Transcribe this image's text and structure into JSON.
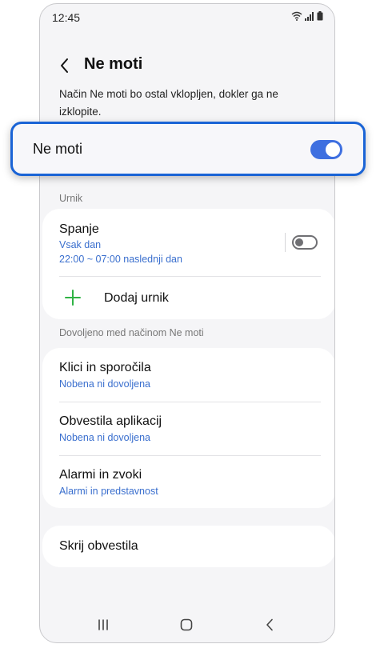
{
  "status_bar": {
    "time": "12:45"
  },
  "header": {
    "title": "Ne moti"
  },
  "description": "Način Ne moti bo ostal vklopljen, dokler ga ne izklopite.",
  "master_toggle": {
    "label": "Ne moti",
    "state": "on",
    "accent_color": "#3e6fe0"
  },
  "schedule_section": {
    "label": "Urnik",
    "schedules": [
      {
        "title": "Spanje",
        "days": "Vsak dan",
        "time": "22:00 ~ 07:00 naslednji dan",
        "toggle": "off"
      }
    ],
    "add_label": "Dodaj urnik"
  },
  "allowed_section": {
    "label": "Dovoljeno med načinom Ne moti",
    "items": [
      {
        "title": "Klici in sporočila",
        "subtitle": "Nobena ni dovoljena"
      },
      {
        "title": "Obvestila aplikacij",
        "subtitle": "Nobena ni dovoljena"
      },
      {
        "title": "Alarmi in zvoki",
        "subtitle": "Alarmi in predstavnost"
      }
    ]
  },
  "hide_notifications": {
    "label": "Skrij obvestila"
  },
  "nav_bar": {
    "buttons": [
      "recents-icon",
      "home-icon",
      "back-icon"
    ]
  },
  "colors": {
    "highlight_border": "#1a64d6",
    "link_blue": "#3a6fce",
    "add_green": "#2fb344"
  }
}
